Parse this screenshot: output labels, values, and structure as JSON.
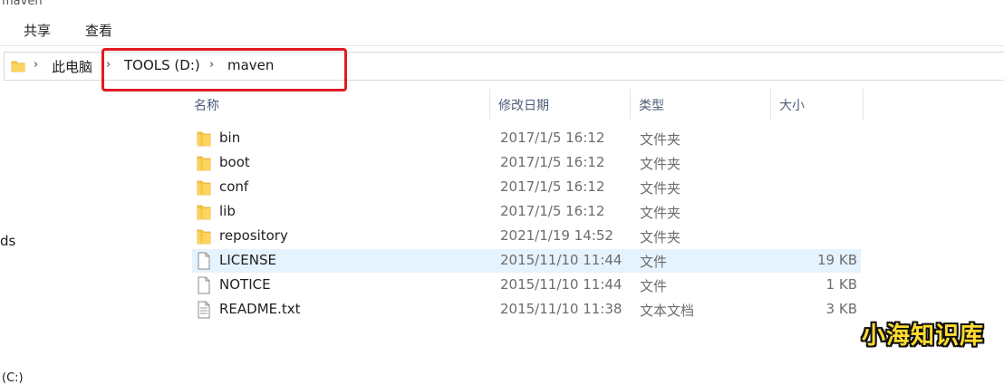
{
  "window": {
    "title": "maven"
  },
  "ribbon": {
    "tabs": [
      "共享",
      "查看"
    ]
  },
  "address": {
    "crumbs": [
      "此电脑",
      "TOOLS (D:)",
      "maven"
    ]
  },
  "nav_pane": {
    "items": [
      "ds",
      "(C:)"
    ]
  },
  "columns": {
    "name": "名称",
    "date": "修改日期",
    "type": "类型",
    "size": "大小"
  },
  "files": [
    {
      "name": "bin",
      "date": "2017/1/5 16:12",
      "type": "文件夹",
      "size": "",
      "icon": "folder-icon"
    },
    {
      "name": "boot",
      "date": "2017/1/5 16:12",
      "type": "文件夹",
      "size": "",
      "icon": "folder-icon"
    },
    {
      "name": "conf",
      "date": "2017/1/5 16:12",
      "type": "文件夹",
      "size": "",
      "icon": "folder-icon"
    },
    {
      "name": "lib",
      "date": "2017/1/5 16:12",
      "type": "文件夹",
      "size": "",
      "icon": "folder-icon"
    },
    {
      "name": "repository",
      "date": "2021/1/19 14:52",
      "type": "文件夹",
      "size": "",
      "icon": "folder-icon"
    },
    {
      "name": "LICENSE",
      "date": "2015/11/10 11:44",
      "type": "文件",
      "size": "19 KB",
      "icon": "file-icon",
      "selected": true
    },
    {
      "name": "NOTICE",
      "date": "2015/11/10 11:44",
      "type": "文件",
      "size": "1 KB",
      "icon": "file-icon"
    },
    {
      "name": "README.txt",
      "date": "2015/11/10 11:38",
      "type": "文本文档",
      "size": "3 KB",
      "icon": "text-file-icon"
    }
  ],
  "watermark": "小海知识库",
  "colors": {
    "highlight_box": "#e21a22",
    "selected_row": "#e5f3ff",
    "folder": "#f8c94a",
    "watermark": "#ffdc2e"
  }
}
